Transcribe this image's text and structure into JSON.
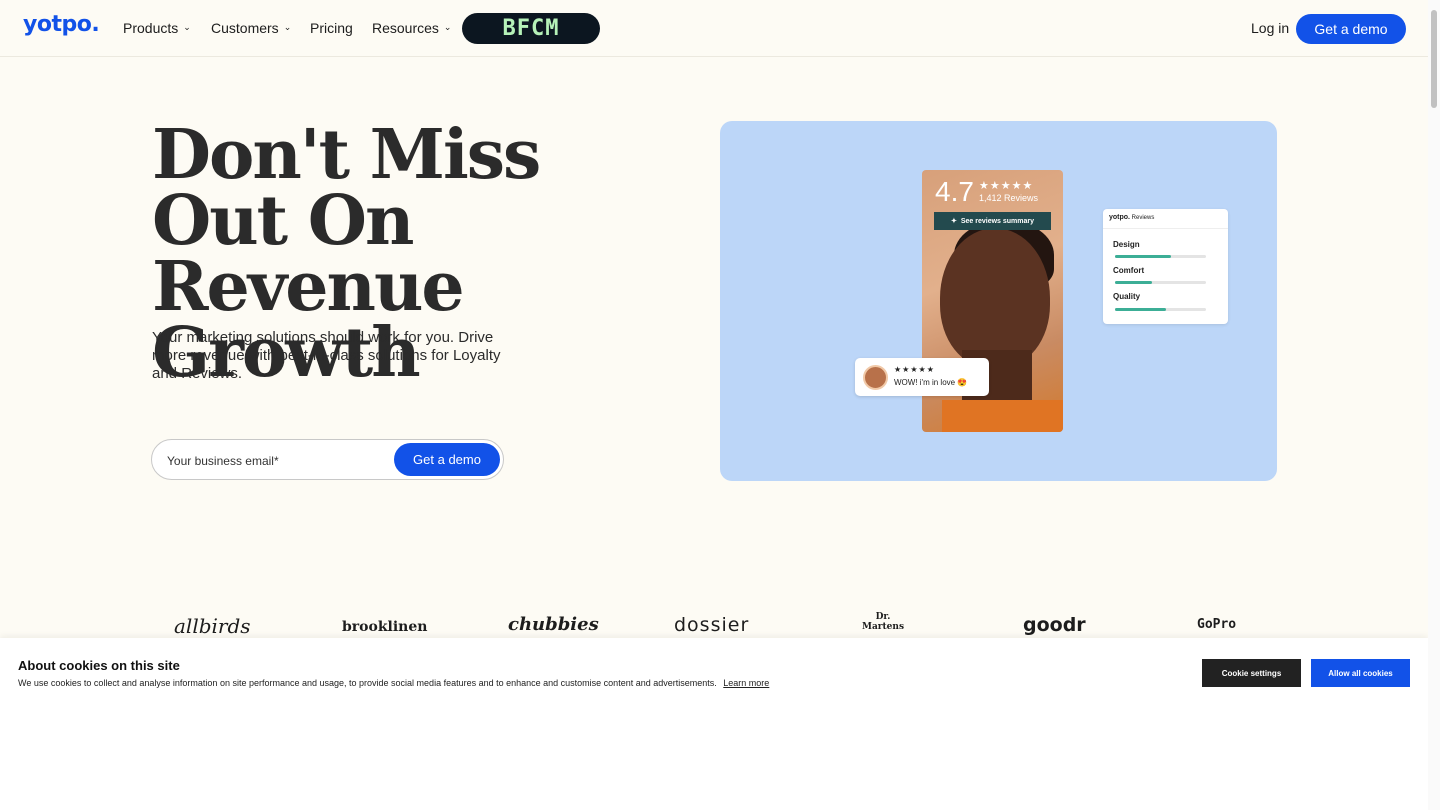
{
  "nav": {
    "logo": "yotpo.",
    "items": [
      {
        "label": "Products",
        "dropdown": true
      },
      {
        "label": "Customers",
        "dropdown": true
      },
      {
        "label": "Pricing",
        "dropdown": false
      },
      {
        "label": "Resources",
        "dropdown": true
      }
    ],
    "promo_badge": "BFCM",
    "login_label": "Log in",
    "demo_label": "Get a demo"
  },
  "hero": {
    "title": "Don't Miss Out On Revenue Growth",
    "subtitle": "Your marketing solutions should work for you. Drive more revenue with best-in-class solutions for Loyalty and Reviews.",
    "email_placeholder": "Your business email*",
    "cta_label": "Get a demo"
  },
  "illustration": {
    "rating": "4.7",
    "stars": "★★★★★",
    "review_count": "1,412 Reviews",
    "summary_button": "See reviews summary",
    "review_chip": {
      "stars": "★★★★★",
      "text": "WOW! i'm in love 😍"
    },
    "card": {
      "brand": "yotpo.",
      "label": "Reviews",
      "attributes": [
        {
          "name": "Design",
          "level": 0.62
        },
        {
          "name": "Comfort",
          "level": 0.41
        },
        {
          "name": "Quality",
          "level": 0.56
        }
      ]
    },
    "accent_color": "#3cae96",
    "background_color": "#bcd6f8"
  },
  "brands": [
    "allbirds",
    "brooklinen",
    "chubbies",
    "dossier",
    "Dr. Martens",
    "goodr",
    "GoPro"
  ],
  "cookie_banner": {
    "title": "About cookies on this site",
    "text": "We use cookies to collect and analyse information on site performance and usage, to provide social media features and to enhance and customise content and advertisements.",
    "learn_more": "Learn more",
    "settings_label": "Cookie settings",
    "allow_label": "Allow all cookies"
  },
  "colors": {
    "brand_blue": "#1252e8",
    "page_bg": "#fdfbf4"
  }
}
